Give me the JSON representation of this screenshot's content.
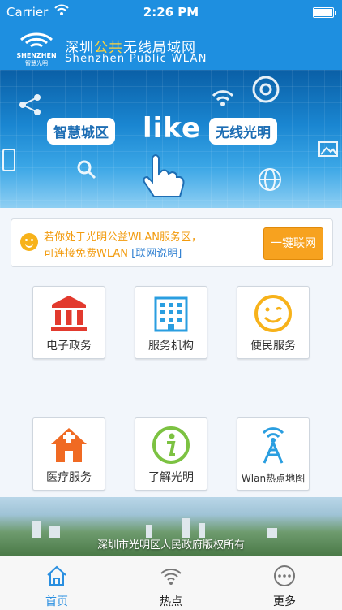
{
  "status_bar": {
    "carrier": "Carrier",
    "time": "2:26 PM"
  },
  "header": {
    "logo_text_top": "SHENZHEN",
    "logo_text_bottom": "智慧光明",
    "title_cn_part1": "深圳",
    "title_cn_highlight": "公共",
    "title_cn_part2": "无线局域网",
    "title_en": "Shenzhen Public WLAN"
  },
  "banner": {
    "left_pill": "智慧城区",
    "center": "like",
    "right_pill": "无线光明"
  },
  "notice": {
    "line1": "若你处于光明公益WLAN服务区，",
    "line2_prefix": "可连接免费WLAN ",
    "link": "[联网说明]",
    "button": "一键联网"
  },
  "tiles": [
    {
      "label": "电子政务",
      "icon": "government-building-icon"
    },
    {
      "label": "服务机构",
      "icon": "office-building-icon"
    },
    {
      "label": "便民服务",
      "icon": "smiley-face-icon"
    },
    {
      "label": "医疗服务",
      "icon": "hospital-icon"
    },
    {
      "label": "了解光明",
      "icon": "info-icon"
    },
    {
      "label": "Wlan热点地图",
      "icon": "wifi-tower-icon"
    }
  ],
  "footer": {
    "copyright": "深圳市光明区人民政府版权所有"
  },
  "tabbar": [
    {
      "label": "首页",
      "icon": "home-icon",
      "active": true
    },
    {
      "label": "热点",
      "icon": "wifi-icon",
      "active": false
    },
    {
      "label": "更多",
      "icon": "more-icon",
      "active": false
    }
  ],
  "colors": {
    "brand": "#1e8fe0",
    "accent": "#f7a21f",
    "red": "#e23a2e",
    "green": "#7cc242"
  }
}
